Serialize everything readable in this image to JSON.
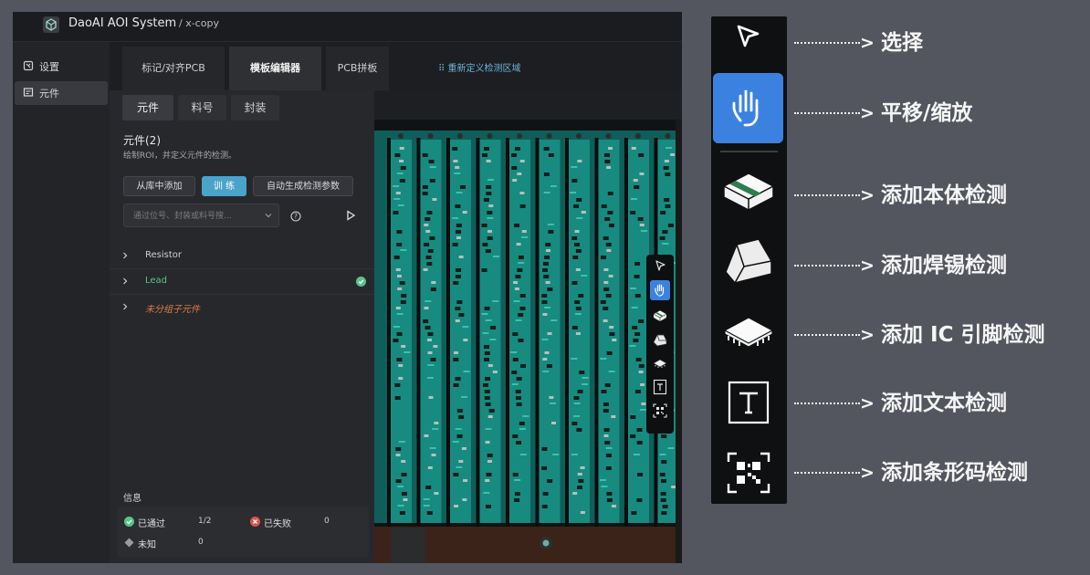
{
  "app": {
    "title": "DaoAI AOI System",
    "path": "/ x-copy"
  },
  "sidebar": {
    "items": [
      {
        "label": "设置",
        "icon": "settings-icon"
      },
      {
        "label": "元件",
        "icon": "component-icon"
      }
    ]
  },
  "top_tabs": [
    "标记/对齐PCB",
    "模板编辑器",
    "PCB拼板"
  ],
  "redefine_region": "重新定义检测区域",
  "sub_tabs": [
    "元件",
    "料号",
    "封装"
  ],
  "components": {
    "title": "元件(2)",
    "description": "绘制ROI，并定义元件的检测。",
    "buttons": {
      "add_from_library": "从库中添加",
      "train": "训 练",
      "auto_generate": "自动生成检测参数"
    },
    "search_placeholder": "通过位号、封装或料号搜...",
    "groups": [
      {
        "name": "Resistor",
        "status": ""
      },
      {
        "name": "Lead",
        "status": "passed"
      },
      {
        "name": "未分组子元件",
        "status": ""
      }
    ]
  },
  "info": {
    "label": "信息",
    "passed": {
      "label": "已通过",
      "value": "1/2"
    },
    "failed": {
      "label": "已失败",
      "value": "0"
    },
    "unknown": {
      "label": "未知",
      "value": "0"
    }
  },
  "colors": {
    "accent": "#4aa3c8",
    "pass": "#59c38a",
    "fail": "#e0524e",
    "ungrouped": "#e07d45",
    "selected_tool": "#3b82e0"
  },
  "toolbar_icons": [
    "select-icon",
    "pan-icon",
    "body-inspect-icon",
    "solder-inspect-icon",
    "ic-pin-inspect-icon",
    "text-inspect-icon",
    "barcode-inspect-icon"
  ],
  "legend": [
    {
      "icon": "select-icon",
      "arrow": ">",
      "label": "选择"
    },
    {
      "icon": "pan-zoom-icon",
      "arrow": ">",
      "label": "平移/缩放"
    },
    {
      "icon": "body-inspect-icon",
      "arrow": ">",
      "label": "添加本体检测"
    },
    {
      "icon": "solder-inspect-icon",
      "arrow": ">",
      "label": "添加焊锡检测"
    },
    {
      "icon": "ic-pin-inspect-icon",
      "arrow": ">",
      "label": "添加 IC 引脚检测"
    },
    {
      "icon": "text-inspect-icon",
      "arrow": ">",
      "label": "添加文本检测"
    },
    {
      "icon": "barcode-inspect-icon",
      "arrow": ">",
      "label": "添加条形码检测"
    }
  ]
}
